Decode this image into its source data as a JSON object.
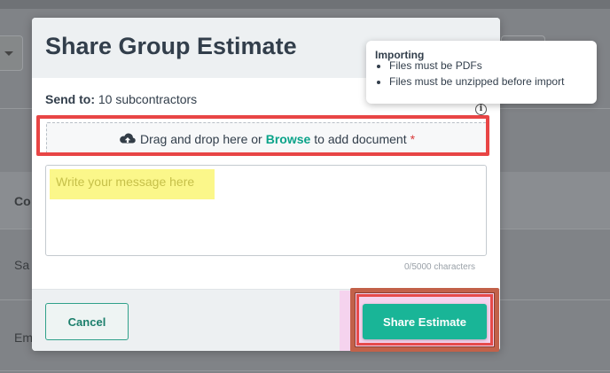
{
  "background": {
    "column_header": "Co",
    "row_1": "Sa",
    "row_2": "Em"
  },
  "modal": {
    "title": "Share Group Estimate",
    "send_to_label": "Send to:",
    "send_to_value": "10 subcontractors",
    "dropzone": {
      "text_before": "Drag and drop here or",
      "browse_link": "Browse",
      "text_after": "to add document",
      "required_mark": "*",
      "icon": "cloud-upload-icon"
    },
    "message": {
      "placeholder": "Write your message here",
      "char_count": "0/5000 characters"
    },
    "info_icon_glyph": "i",
    "footer": {
      "cancel_label": "Cancel",
      "share_label": "Share Estimate"
    }
  },
  "tooltip": {
    "title": "Importing",
    "items": [
      "Files must be PDFs",
      "Files must be unzipped before import"
    ]
  },
  "colors": {
    "accent": "#19b597",
    "browse_link": "#0aa389",
    "required": "#d93a3a",
    "highlight_red": "#e84545",
    "message_highlight": "#fbf78a"
  }
}
